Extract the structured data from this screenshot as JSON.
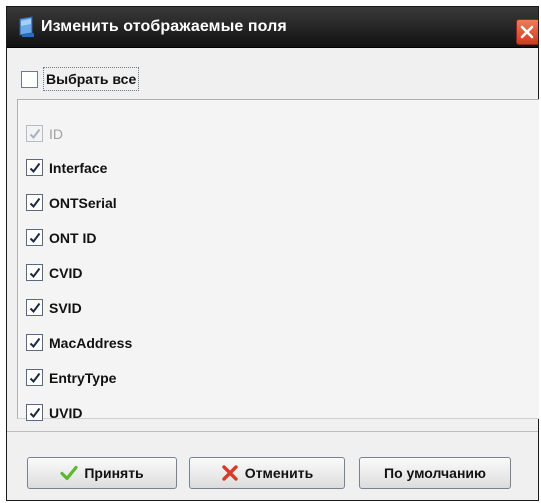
{
  "dialog": {
    "title": "Изменить отображаемые поля",
    "close_icon": "close-icon"
  },
  "select_all": {
    "label": "Выбрать все",
    "checked": false
  },
  "fields": [
    {
      "label": "ID",
      "checked": true,
      "enabled": false
    },
    {
      "label": "Interface",
      "checked": true,
      "enabled": true
    },
    {
      "label": "ONTSerial",
      "checked": true,
      "enabled": true
    },
    {
      "label": "ONT ID",
      "checked": true,
      "enabled": true
    },
    {
      "label": "CVID",
      "checked": true,
      "enabled": true
    },
    {
      "label": "SVID",
      "checked": true,
      "enabled": true
    },
    {
      "label": "MacAddress",
      "checked": true,
      "enabled": true
    },
    {
      "label": "EntryType",
      "checked": true,
      "enabled": true
    },
    {
      "label": "UVID",
      "checked": true,
      "enabled": true
    }
  ],
  "buttons": {
    "accept": {
      "label": "Принять",
      "icon": "checkmark-icon",
      "color": "#5cb82e"
    },
    "cancel": {
      "label": "Отменить",
      "icon": "cross-icon",
      "color": "#d83a2a"
    },
    "defaults": {
      "label": "По умолчанию"
    }
  }
}
